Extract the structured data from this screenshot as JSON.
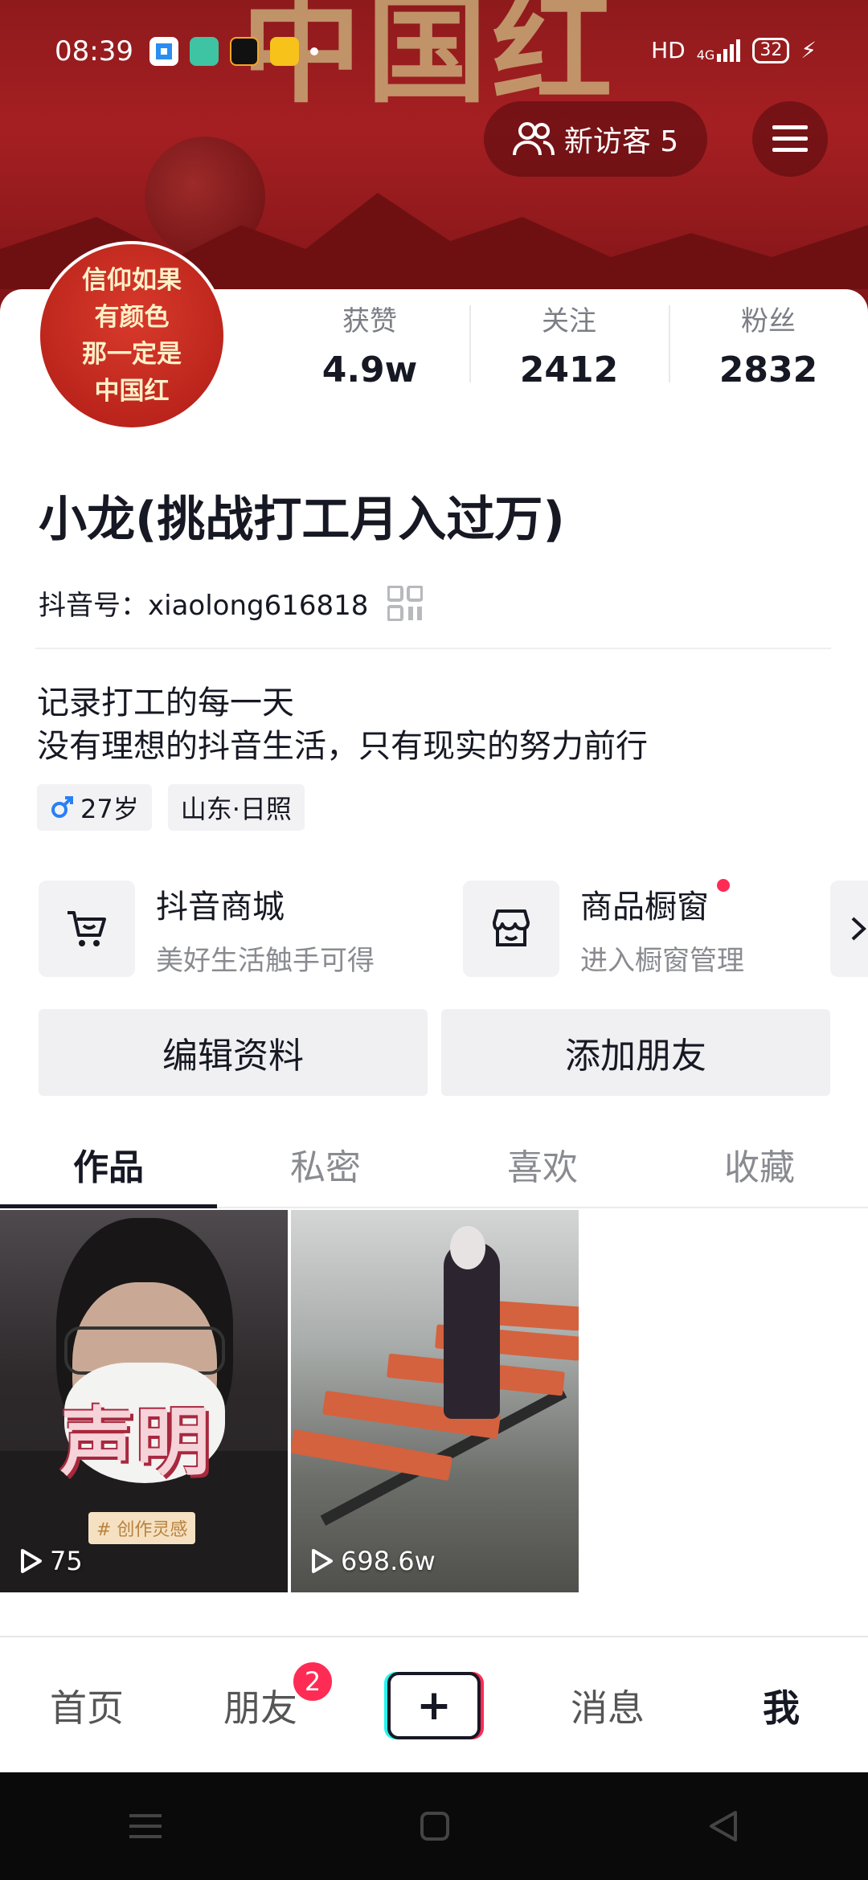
{
  "status_bar": {
    "time": "08:39",
    "network": "HD",
    "signal": "4G",
    "battery": "32"
  },
  "banner": {
    "title": "中国红",
    "visitor_label": "新访客 5"
  },
  "avatar": {
    "lines": [
      "信仰如果",
      "有颜色",
      "那一定是",
      "中国红"
    ]
  },
  "stats": [
    {
      "label": "获赞",
      "value": "4.9w"
    },
    {
      "label": "关注",
      "value": "2412"
    },
    {
      "label": "粉丝",
      "value": "2832"
    }
  ],
  "profile": {
    "nickname": "小龙(挑战打工月入过万)",
    "douyin_id": "抖音号：xiaolong616818",
    "bio_line1": "记录打工的每一天",
    "bio_line2": "没有理想的抖音生活，只有现实的努力前行",
    "tags": [
      {
        "icon": "male-icon",
        "label": "27岁"
      },
      {
        "label": "山东·日照"
      }
    ]
  },
  "services": [
    {
      "title": "抖音商城",
      "subtitle": "美好生活触手可得",
      "icon": "cart-icon"
    },
    {
      "title": "商品橱窗",
      "subtitle": "进入橱窗管理",
      "icon": "store-icon"
    }
  ],
  "actions": {
    "edit": "编辑资料",
    "add_friend": "添加朋友"
  },
  "tabs": [
    "作品",
    "私密",
    "喜欢",
    "收藏"
  ],
  "videos": [
    {
      "plays": "75",
      "overlay_text": "声明",
      "chip": "# 创作灵感"
    },
    {
      "plays": "698.6w"
    }
  ],
  "bottom_nav": {
    "home": "首页",
    "friends": "朋友",
    "friends_badge": "2",
    "messages": "消息",
    "me": "我"
  }
}
